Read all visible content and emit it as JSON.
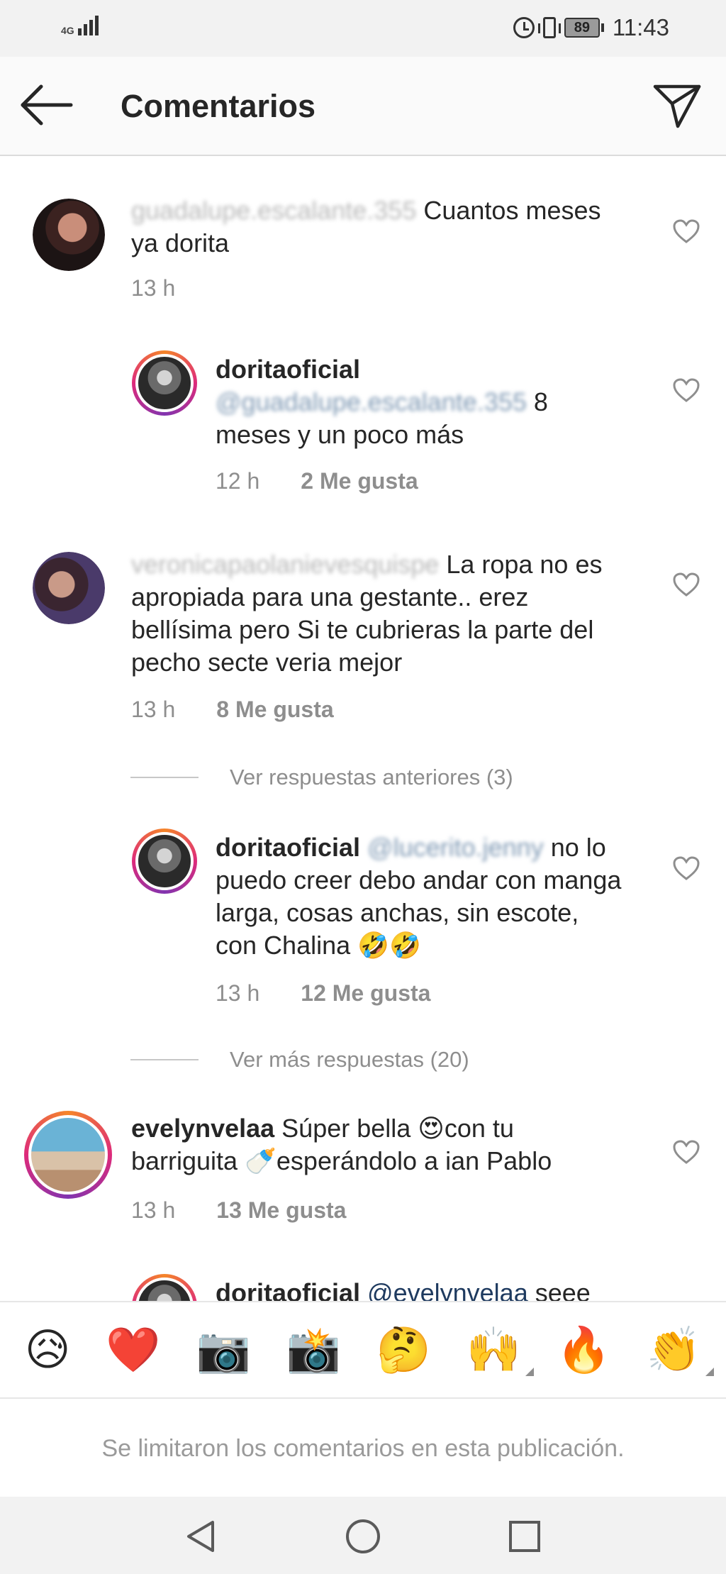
{
  "status_bar": {
    "network_label": "4G",
    "battery": "89",
    "time": "11:43"
  },
  "header": {
    "title": "Comentarios",
    "back_icon": "arrow-left-icon",
    "send_icon": "paper-plane-icon"
  },
  "comments": [
    {
      "username": "guadalupe.escalante.355",
      "text": " Cuantos meses ya dorita",
      "time": "13 h",
      "likes": ""
    },
    {
      "username": "doritaoficial",
      "mention": "@guadalupe.escalante.355",
      "text": " 8 meses y un poco más",
      "time": "12 h",
      "likes": "2 Me gusta"
    },
    {
      "username": "veronicapaolanievesquispe",
      "text": " La ropa no es apropiada para una gestante.. erez bellísima pero Si te cubrieras la parte del pecho secte veria mejor",
      "time": "13 h",
      "likes": "8 Me gusta"
    },
    {
      "username": "doritaoficial",
      "mention": "@lucerito.jenny",
      "text": " no lo puedo creer debo andar con manga larga, cosas anchas, sin escote, con Chalina 🤣🤣",
      "time": "13 h",
      "likes": "12 Me gusta"
    },
    {
      "username": "evelynvelaa",
      "text": " Súper bella 😍con tu barriguita 🍼esperándolo a ian Pablo",
      "time": "13 h",
      "likes": "13 Me gusta"
    },
    {
      "username": "doritaoficial",
      "mention": "@evelynvelaa",
      "text": " seee"
    }
  ],
  "view_replies": [
    "Ver respuestas anteriores (3)",
    "Ver más respuestas (20)"
  ],
  "emoji_bar": [
    "😥",
    "❤️",
    "📷",
    "📸",
    "🤔",
    "🙌",
    "🔥",
    "👏"
  ],
  "limited_notice": "Se limitaron los comentarios en esta publicación.",
  "colors": {
    "mention": "#1e3a5f",
    "meta_gray": "#8e8e8e",
    "heart_outline": "#8e8e8e",
    "story_ring": "#dd2a7b"
  }
}
